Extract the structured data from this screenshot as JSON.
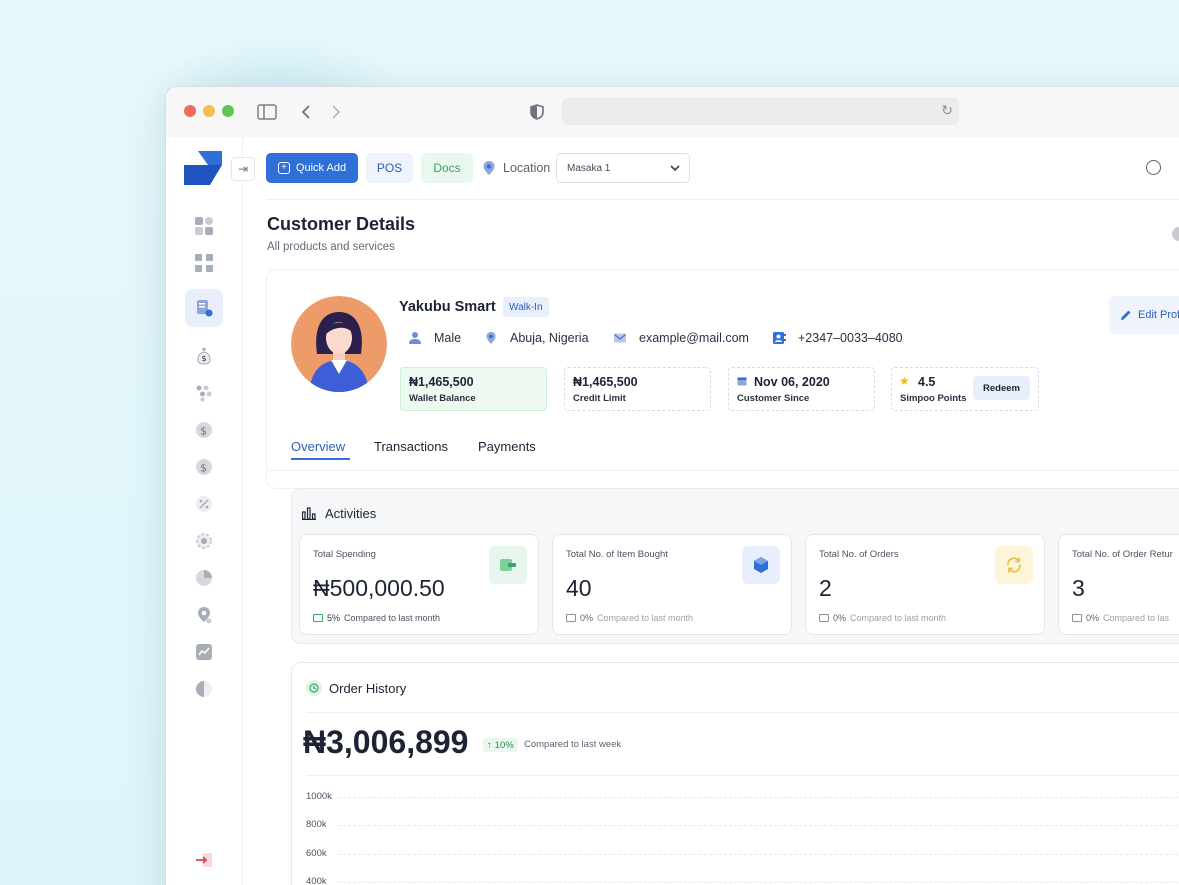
{
  "topbar": {
    "quick_add_label": "Quick Add",
    "pos_label": "POS",
    "docs_label": "Docs",
    "location_label": "Location",
    "location_value": "Masaka 1"
  },
  "page": {
    "title": "Customer Details",
    "subtitle": "All products and services"
  },
  "customer": {
    "name": "Yakubu Smart",
    "type_badge": "Walk-In",
    "gender": "Male",
    "location": "Abuja, Nigeria",
    "email": "example@mail.com",
    "phone": "+2347–0033–4080",
    "edit_label": "Edit Prof"
  },
  "stats": {
    "wallet_value": "₦1,465,500",
    "wallet_label": "Wallet Balance",
    "credit_value": "₦1,465,500",
    "credit_label": "Credit Limit",
    "since_value": "Nov 06, 2020",
    "since_label": "Customer Since",
    "points_value": "4.5",
    "points_label": "Simpoo Points",
    "redeem_label": "Redeem"
  },
  "tabs": [
    "Overview",
    "Transactions",
    "Payments"
  ],
  "activities": {
    "title": "Activities",
    "cards": [
      {
        "label": "Total Spending",
        "value": "₦500,000.50",
        "pct": "5%",
        "compare": "Compared to last month"
      },
      {
        "label": "Total No. of Item Bought",
        "value": "40",
        "pct": "0%",
        "compare": "Compared to last month"
      },
      {
        "label": "Total No. of Orders",
        "value": "2",
        "pct": "0%",
        "compare": "Compared to last month"
      },
      {
        "label": "Total No. of Order Retur",
        "value": "3",
        "pct": "0%",
        "compare": "Compared to las"
      }
    ]
  },
  "order_history": {
    "title": "Order History",
    "amount": "₦3,006,899",
    "pct": "10%",
    "compare": "Compared to last week",
    "y_ticks": [
      "1000k",
      "800k",
      "600k",
      "400k"
    ]
  },
  "colors": {
    "accent": "#2f6fd8",
    "docs_green": "#3aa565",
    "logout_red": "#e0455e"
  }
}
